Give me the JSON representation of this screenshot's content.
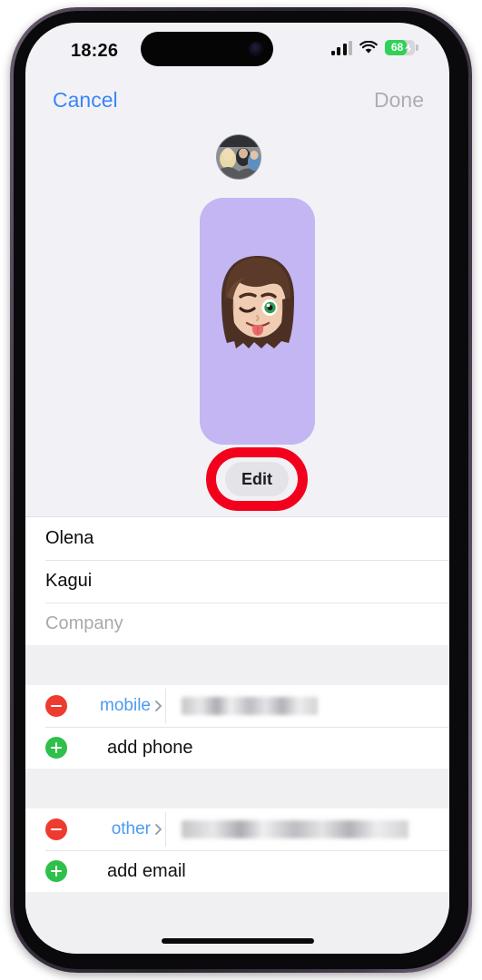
{
  "status_bar": {
    "time": "18:26",
    "battery_percent": "68",
    "battery_level": 68,
    "charging": true,
    "cellular_bars": 3,
    "wifi": "wifi-icon",
    "battery_color": "#30d158"
  },
  "nav": {
    "cancel_label": "Cancel",
    "done_label": "Done",
    "cancel_color": "#3c86f4",
    "done_color": "#aeaeb2"
  },
  "photo_section": {
    "thumbnail_alt": "contact-photo-thumbnail",
    "memoji_card_color": "#c3b6f2",
    "memoji_alt": "memoji-winking-tongue-out",
    "edit_label": "Edit",
    "highlight_color": "#f3001d"
  },
  "name_fields": [
    {
      "name": "first-name",
      "value": "Olena",
      "is_placeholder": false
    },
    {
      "name": "last-name",
      "value": "Kagui",
      "is_placeholder": false
    },
    {
      "name": "company",
      "value": "Company",
      "is_placeholder": true
    }
  ],
  "phone_section": {
    "entry_label": "mobile",
    "entry_value_redacted": true,
    "add_label": "add phone"
  },
  "email_section": {
    "entry_label": "other",
    "entry_value_redacted": true,
    "add_label": "add email"
  },
  "colors": {
    "accent_blue": "#4a9bf0",
    "remove_red": "#ee3b30",
    "add_green": "#2fc04c",
    "group_background": "#f0f0f3"
  }
}
